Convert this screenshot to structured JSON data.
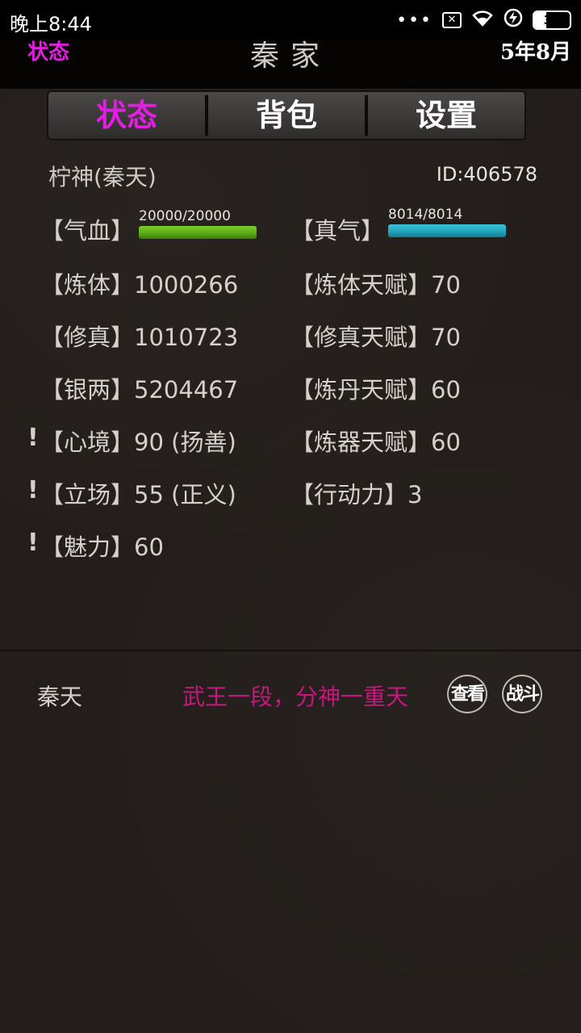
{
  "statusbar": {
    "time": "晚上8:44",
    "dots": "•••",
    "battery": "34",
    "battery_level": 0.34
  },
  "header": {
    "left_label": "状态",
    "title": "秦家",
    "date": "5年8月"
  },
  "tabs": [
    {
      "label": "状态",
      "active": true
    },
    {
      "label": "背包",
      "active": false
    },
    {
      "label": "设置",
      "active": false
    }
  ],
  "character": {
    "name": "柠神(秦天)",
    "id": "ID:406578"
  },
  "bars": {
    "hp": {
      "label": "【气血】",
      "text": "20000/20000",
      "fraction": 1.0,
      "color": "#5aa818"
    },
    "qi": {
      "label": "【真气】",
      "text": "8014/8014",
      "fraction": 1.0,
      "color": "#1fa2b8"
    }
  },
  "stats_left": [
    {
      "label": "【炼体】",
      "value": "1000266"
    },
    {
      "label": "【修真】",
      "value": "1010723"
    },
    {
      "label": "【银两】",
      "value": "5204467"
    },
    {
      "label": "【心境】",
      "value": "90 (扬善)",
      "warn": "!"
    },
    {
      "label": "【立场】",
      "value": "55 (正义)",
      "warn": "!"
    },
    {
      "label": "【魅力】",
      "value": "60",
      "warn": "!"
    }
  ],
  "stats_right": [
    {
      "label": "【炼体天赋】",
      "value": "70"
    },
    {
      "label": "【修真天赋】",
      "value": "70"
    },
    {
      "label": "【炼丹天赋】",
      "value": "60"
    },
    {
      "label": "【炼器天赋】",
      "value": "60"
    },
    {
      "label": "【行动力】",
      "value": "3"
    }
  ],
  "bottom": {
    "name": "秦天",
    "rank": "武王一段，分神一重天",
    "view_btn": "查看",
    "fight_btn": "战斗"
  },
  "colors": {
    "accent": "#e21fe0",
    "rank": "#c4187a"
  }
}
